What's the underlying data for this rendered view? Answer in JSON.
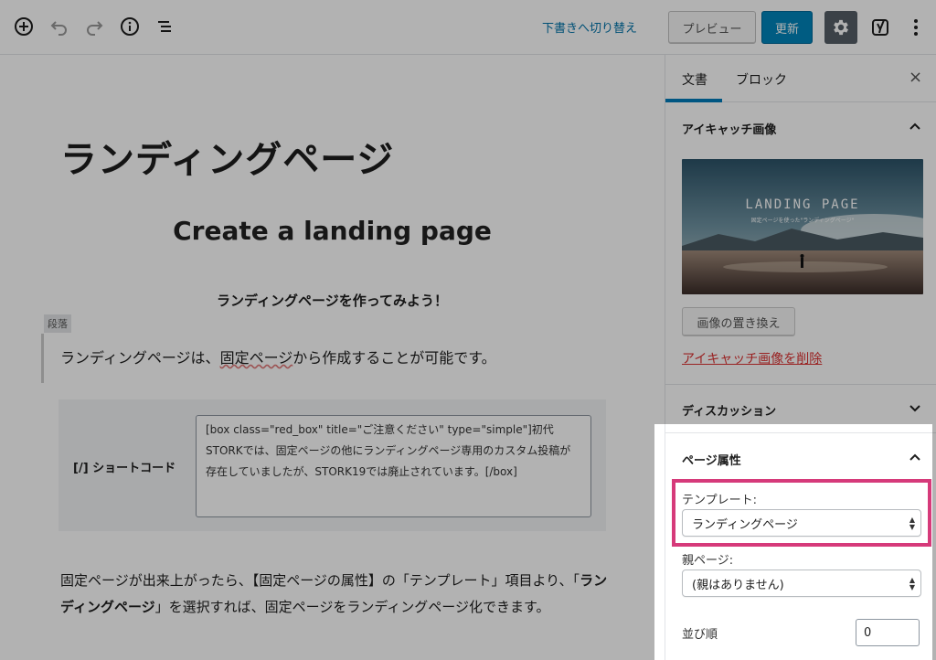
{
  "toolbar": {
    "switch_draft_label": "下書きへ切り替え",
    "preview_label": "プレビュー",
    "update_label": "更新",
    "icons": [
      "add-block-icon",
      "undo-icon",
      "redo-icon",
      "info-icon",
      "outline-icon",
      "gear-icon",
      "yoast-icon",
      "more-vertical-icon"
    ]
  },
  "editor": {
    "post_title": "ランディングページ",
    "heading": "Create a landing page",
    "subheading": "ランディングページを作ってみよう！",
    "block_label": "段落",
    "para1_before": "ランディングページは、",
    "para1_marked": "固定ページ",
    "para1_after": "から作成することが可能です。",
    "shortcode_label": "[/]  ショートコード",
    "shortcode_text": "[box class=\"red_box\" title=\"ご注意ください\" type=\"simple\"]初代STORKでは、固定ページの他にランディングページ専用のカスタム投稿が存在していましたが、STORK19では廃止されています。[/box]",
    "para2_a": "固定ページが出来上がったら、【固定ページの属性】の「テンプレート」項目より、「",
    "para2_bold": "ランディングページ",
    "para2_b": "」を選択すれば、固定ページをランディングページ化できます。"
  },
  "sidebar": {
    "tabs": [
      {
        "label": "文書",
        "active": true
      },
      {
        "label": "ブロック",
        "active": false
      }
    ],
    "close_symbol": "×",
    "featured_image": {
      "title": "アイキャッチ画像",
      "image_heading": "LANDING PAGE",
      "image_sub": "固定ページを使った\"ランディングページ\"",
      "replace_label": "画像の置き換え",
      "remove_label": "アイキャッチ画像を削除"
    },
    "discussion": {
      "title": "ディスカッション"
    },
    "page_attributes": {
      "title": "ページ属性",
      "template_label": "テンプレート:",
      "template_value": "ランディングページ",
      "parent_label": "親ページ:",
      "parent_value": "(親はありません)",
      "order_label": "並び順",
      "order_value": "0"
    }
  },
  "colors": {
    "accent": "#0085ba",
    "link": "#0073aa",
    "danger": "#dc3232",
    "highlight": "#d63a7a"
  }
}
